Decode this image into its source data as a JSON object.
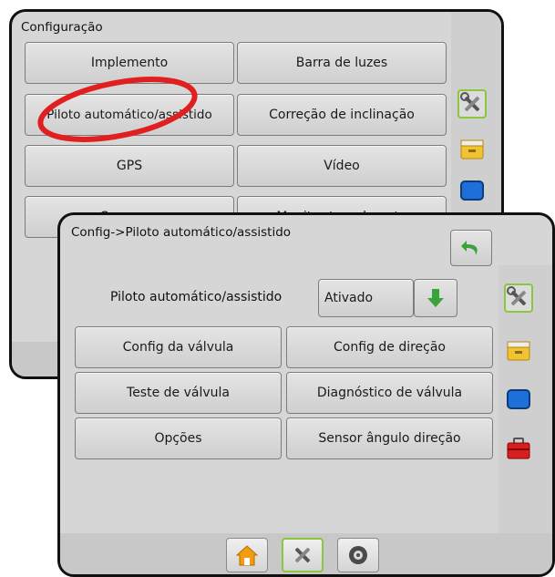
{
  "back_panel": {
    "title": "Configuração",
    "buttons": [
      "Implemento",
      "Barra de luzes",
      "Piloto automático/assistido",
      "Correção de inclinação",
      "GPS",
      "Vídeo",
      "Sensores",
      "Monitor tam da gota"
    ]
  },
  "front_panel": {
    "title": "Config->Piloto automático/assistido",
    "setting_label": "Piloto automático/assistido",
    "setting_value": "Ativado",
    "buttons": [
      "Config da válvula",
      "Config de direção",
      "Teste de válvula",
      "Diagnóstico de válvula",
      "Opções",
      "Sensor ângulo direção"
    ]
  },
  "side_icons": [
    "tools-icon",
    "console-icon",
    "display-icon",
    "toolbox-icon"
  ],
  "bottom_tabs": [
    "home-icon",
    "tools-icon",
    "settings-wheel-icon"
  ],
  "colors": {
    "accent_green": "#8cc63f",
    "annotation_red": "#e02020"
  }
}
